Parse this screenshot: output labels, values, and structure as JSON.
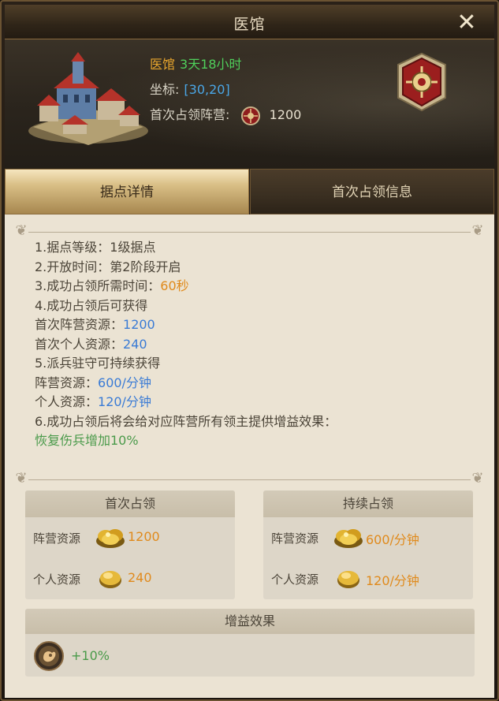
{
  "window": {
    "title": "医馆",
    "close_symbol": "✕"
  },
  "header": {
    "building_name": "医馆",
    "time_left": "3天18小时",
    "coord_label": "坐标:",
    "coord_value": "[30,20]",
    "first_camp_label": "首次占领阵营:",
    "first_camp_value": "1200"
  },
  "tabs": [
    {
      "label": "据点详情",
      "active": true
    },
    {
      "label": "首次占领信息",
      "active": false
    }
  ],
  "description": {
    "l1": "1.据点等级：1级据点",
    "l2": "2.开放时间：第2阶段开启",
    "l3_prefix": "3.成功占领所需时间：",
    "l3_value": "60秒",
    "l4": "4.成功占领后可获得",
    "l5_prefix": "首次阵营资源：",
    "l5_value": "1200",
    "l6_prefix": "首次个人资源：",
    "l6_value": "240",
    "l7": "5.派兵驻守可持续获得",
    "l8_prefix": "阵营资源：",
    "l8_value": "600/分钟",
    "l9_prefix": "个人资源：",
    "l9_value": "120/分钟",
    "l10": "6.成功占领后将会给对应阵营所有领主提供增益效果：",
    "l11": "恢复伤兵增加10%"
  },
  "first_occupy": {
    "title": "首次占领",
    "camp_label": "阵营资源",
    "camp_value": "1200",
    "personal_label": "个人资源",
    "personal_value": "240"
  },
  "continuous_occupy": {
    "title": "持续占领",
    "camp_label": "阵营资源",
    "camp_value": "600/分钟",
    "personal_label": "个人资源",
    "personal_value": "120/分钟"
  },
  "buff": {
    "title": "增益效果",
    "value": "+10%"
  },
  "colors": {
    "accent_orange": "#e08a1c",
    "accent_green": "#4a9a4a",
    "accent_blue": "#3a7bd5"
  }
}
